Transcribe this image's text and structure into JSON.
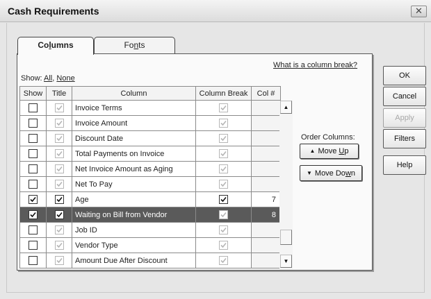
{
  "window": {
    "title": "Cash Requirements",
    "close_glyph": "✕"
  },
  "tabs": [
    {
      "pre": "Co",
      "u": "l",
      "post": "umns",
      "active": true
    },
    {
      "pre": "Fo",
      "u": "n",
      "post": "ts",
      "active": false
    }
  ],
  "help_link": "What is a column break?",
  "show": {
    "label": "Show:",
    "all": "All",
    "none": "None"
  },
  "table": {
    "headers": [
      "Show",
      "Title",
      "Column",
      "Column Break",
      "Col #"
    ],
    "rows": [
      {
        "show": false,
        "title": true,
        "title_enabled": false,
        "column": "Invoice Terms",
        "column_break": true,
        "break_enabled": false,
        "col_num": "",
        "selected": false
      },
      {
        "show": false,
        "title": true,
        "title_enabled": false,
        "column": "Invoice Amount",
        "column_break": true,
        "break_enabled": false,
        "col_num": "",
        "selected": false
      },
      {
        "show": false,
        "title": true,
        "title_enabled": false,
        "column": "Discount Date",
        "column_break": true,
        "break_enabled": false,
        "col_num": "",
        "selected": false
      },
      {
        "show": false,
        "title": true,
        "title_enabled": false,
        "column": "Total Payments on Invoice",
        "column_break": true,
        "break_enabled": false,
        "col_num": "",
        "selected": false
      },
      {
        "show": false,
        "title": true,
        "title_enabled": false,
        "column": "Net Invoice Amount as Aging",
        "column_break": true,
        "break_enabled": false,
        "col_num": "",
        "selected": false
      },
      {
        "show": false,
        "title": true,
        "title_enabled": false,
        "column": "Net To Pay",
        "column_break": true,
        "break_enabled": false,
        "col_num": "",
        "selected": false
      },
      {
        "show": true,
        "title": true,
        "title_enabled": true,
        "column": "Age",
        "column_break": true,
        "break_enabled": true,
        "col_num": "7",
        "selected": false
      },
      {
        "show": true,
        "title": true,
        "title_enabled": true,
        "column": "Waiting on Bill from Vendor",
        "column_break": true,
        "break_enabled": false,
        "col_num": "8",
        "selected": true
      },
      {
        "show": false,
        "title": true,
        "title_enabled": false,
        "column": "Job ID",
        "column_break": true,
        "break_enabled": false,
        "col_num": "",
        "selected": false
      },
      {
        "show": false,
        "title": true,
        "title_enabled": false,
        "column": "Vendor Type",
        "column_break": true,
        "break_enabled": false,
        "col_num": "",
        "selected": false
      },
      {
        "show": false,
        "title": true,
        "title_enabled": false,
        "column": "Amount Due After Discount",
        "column_break": true,
        "break_enabled": false,
        "col_num": "",
        "selected": false
      }
    ]
  },
  "order": {
    "label": "Order Columns:",
    "move_up": {
      "pre": "Move ",
      "u": "U",
      "post": "p"
    },
    "move_down": {
      "pre": "Move Do",
      "u": "w",
      "post": "n"
    }
  },
  "buttons": {
    "ok": "OK",
    "cancel": "Cancel",
    "apply": "Apply",
    "filters": "Filters",
    "help": "Help"
  },
  "icons": {
    "scroll_up": "▲",
    "scroll_down": "▼",
    "move_up_icon": "▲",
    "move_down_icon": "▼",
    "check_icon": "checkmark"
  },
  "colors": {
    "selected_row": "#5a5a5a",
    "disabled_check": "#b6b6b6"
  }
}
